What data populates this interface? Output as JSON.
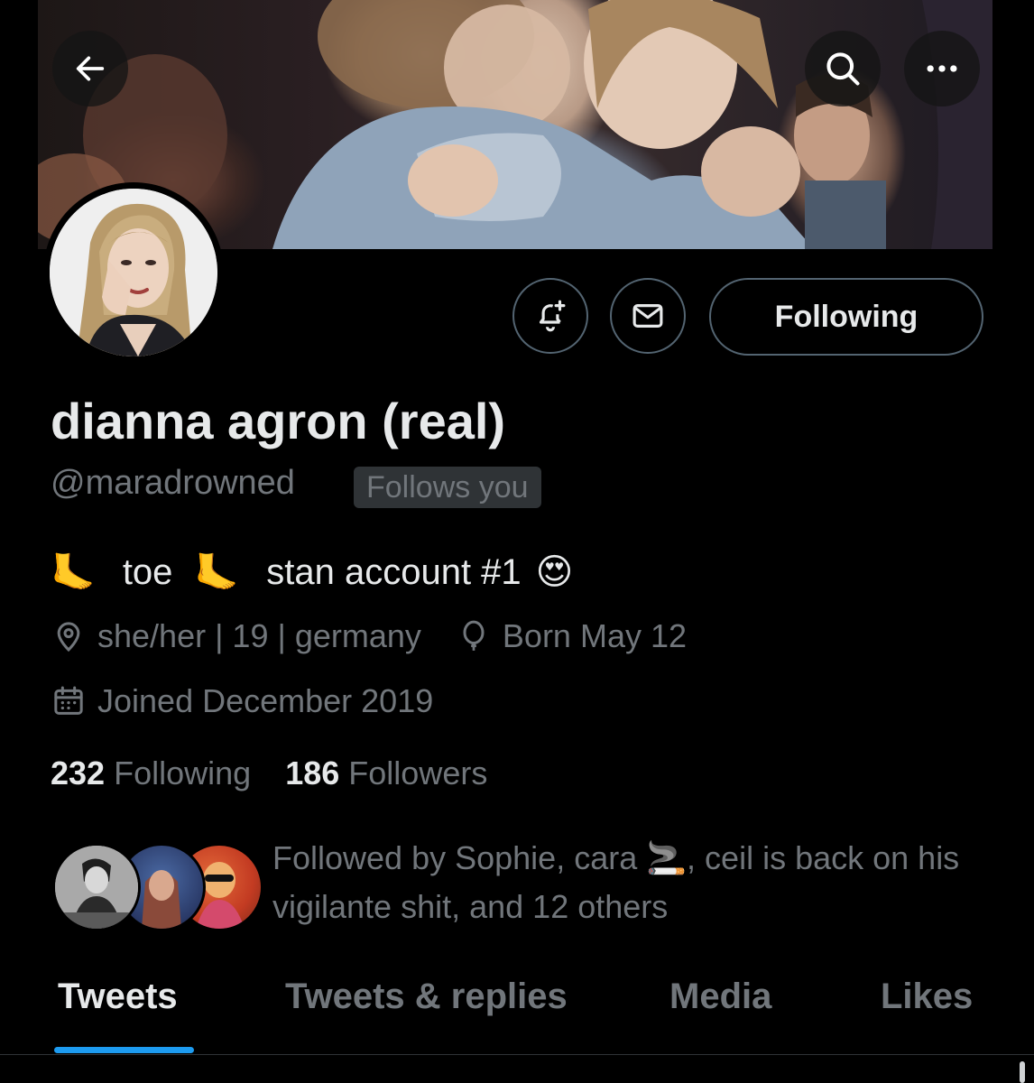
{
  "header": {
    "back_icon": "arrow-left-icon",
    "search_icon": "search-icon",
    "more_icon": "more-horizontal-icon"
  },
  "profile": {
    "display_name": "dianna agron (real)",
    "handle": "@maradrowned",
    "follows_you_badge": "Follows you",
    "bio": {
      "emoji_1": "🦶",
      "word_1": "toe",
      "emoji_2": "🦶",
      "text_2": "stan account #1",
      "emoji_3": "😍"
    },
    "location": "she/her | 19 | germany",
    "birthday": "Born May 12",
    "joined": "Joined December 2019"
  },
  "actions": {
    "notify_icon": "bell-plus-icon",
    "message_icon": "envelope-icon",
    "following_label": "Following"
  },
  "stats": {
    "following_count": "232",
    "following_label": "Following",
    "followers_count": "186",
    "followers_label": "Followers"
  },
  "followed_by": {
    "text": "Followed by Sophie, cara 🚬, ceil is back on his vigilante shit, and 12 others"
  },
  "tabs": [
    {
      "label": "Tweets",
      "active": true
    },
    {
      "label": "Tweets & replies",
      "active": false
    },
    {
      "label": "Media",
      "active": false
    },
    {
      "label": "Likes",
      "active": false
    }
  ],
  "colors": {
    "accent": "#1d9bf0",
    "text_primary": "#e7e9ea",
    "text_secondary": "#71767b",
    "border": "#536471",
    "background": "#000000"
  }
}
